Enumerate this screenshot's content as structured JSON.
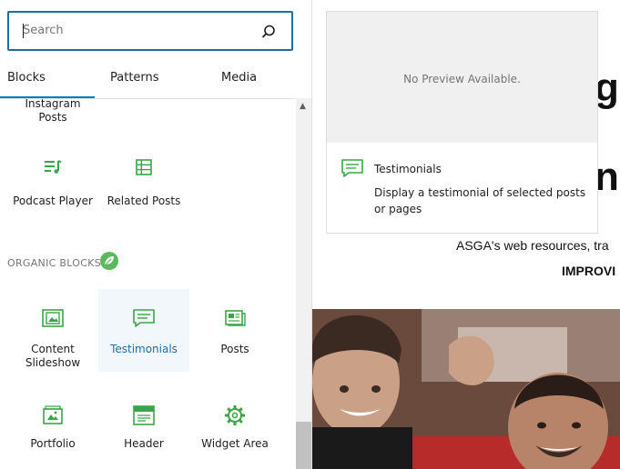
{
  "search": {
    "placeholder": "Search",
    "icon": "search-icon"
  },
  "tabs": [
    {
      "label": "Blocks",
      "active": true
    },
    {
      "label": "Patterns"
    },
    {
      "label": "Media"
    }
  ],
  "blocks_top": [
    {
      "label_line1": "Instagram",
      "label_line2": "Posts"
    },
    {
      "label": "Podcast Player",
      "icon": "podcast-player-icon"
    },
    {
      "label": "Related Posts",
      "icon": "related-posts-icon"
    }
  ],
  "organic": {
    "section_title": "ORGANIC BLOCKS",
    "items": [
      {
        "label_line1": "Content",
        "label_line2": "Slideshow",
        "icon": "content-slideshow-icon"
      },
      {
        "label": "Testimonials",
        "icon": "testimonials-icon",
        "selected": true
      },
      {
        "label": "Posts",
        "icon": "posts-icon"
      },
      {
        "label": "Portfolio",
        "icon": "portfolio-icon"
      },
      {
        "label": "Header",
        "icon": "header-icon"
      },
      {
        "label": "Widget Area",
        "icon": "widget-area-icon"
      }
    ]
  },
  "preview": {
    "no_preview": "No Preview Available.",
    "title": "Testimonials",
    "description": "Display a testimonial of selected posts or pages"
  },
  "page": {
    "heading_fragment_1": "ge",
    "heading_fragment_2": "ng",
    "line1": "ASGA's web resources, tra",
    "line2": "IMPROVI"
  },
  "colors": {
    "accent": "#1c6ea4",
    "block_icon": "#3aa545"
  }
}
